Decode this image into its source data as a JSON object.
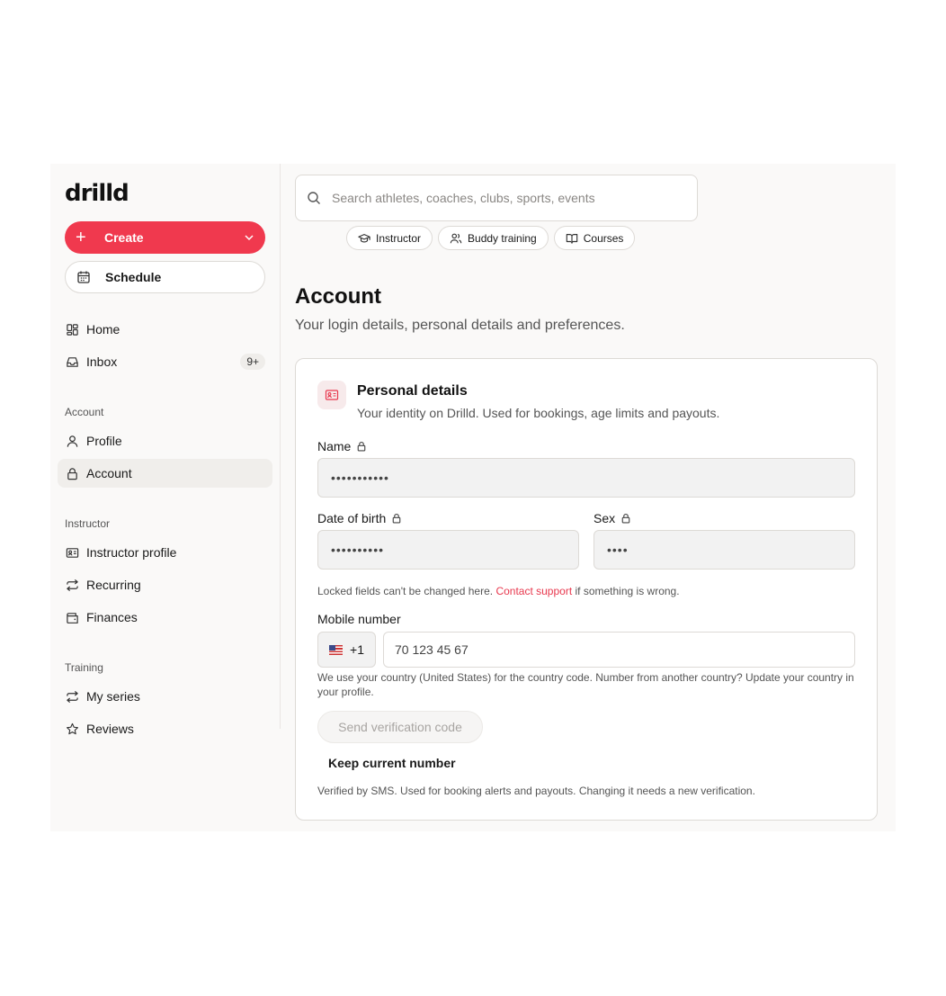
{
  "app": {
    "logo": "drilld"
  },
  "sidebar": {
    "create_label": "Create",
    "schedule_label": "Schedule",
    "items_top": [
      {
        "label": "Home",
        "icon": "grid-icon"
      },
      {
        "label": "Inbox",
        "icon": "inbox-icon",
        "badge": "9+"
      }
    ],
    "sections": [
      {
        "label": "Account",
        "items": [
          {
            "label": "Profile",
            "icon": "user-icon"
          },
          {
            "label": "Account",
            "icon": "lock-icon",
            "active": true
          }
        ]
      },
      {
        "label": "Instructor",
        "items": [
          {
            "label": "Instructor profile",
            "icon": "id-card-icon"
          },
          {
            "label": "Recurring",
            "icon": "repeat-icon"
          },
          {
            "label": "Finances",
            "icon": "wallet-icon"
          }
        ]
      },
      {
        "label": "Training",
        "items": [
          {
            "label": "My series",
            "icon": "repeat-icon"
          },
          {
            "label": "Reviews",
            "icon": "star-icon"
          }
        ]
      }
    ]
  },
  "header": {
    "search_placeholder": "Search athletes, coaches, clubs, sports, events",
    "chips": [
      {
        "label": "Instructor",
        "icon": "graduation-cap-icon"
      },
      {
        "label": "Buddy training",
        "icon": "users-icon"
      },
      {
        "label": "Courses",
        "icon": "book-icon"
      }
    ]
  },
  "page": {
    "title": "Account",
    "subtitle": "Your login details, personal details and preferences."
  },
  "personal_details": {
    "title": "Personal details",
    "description": "Your identity on Drilld. Used for bookings, age limits and payouts.",
    "name_label": "Name",
    "name_value": "•••••••••••",
    "dob_label": "Date of birth",
    "dob_value": "••••••••••",
    "sex_label": "Sex",
    "sex_value": "••••",
    "locked_note_prefix": "Locked fields can't be changed here.",
    "locked_note_link": "Contact support",
    "locked_note_suffix": "if something is wrong.",
    "mobile_label": "Mobile number",
    "country_code": "+1",
    "phone_value": "70 123 45 67",
    "country_note": "We use your country (United States) for the country code. Number from another country? Update your country in your profile.",
    "send_code_label": "Send verification code",
    "keep_number_label": "Keep current number",
    "sms_note": "Verified by SMS. Used for booking alerts and payouts. Changing it needs a new verification."
  },
  "colors": {
    "accent": "#f0394e",
    "link": "#e8384e",
    "app_bg": "#faf9f8"
  }
}
